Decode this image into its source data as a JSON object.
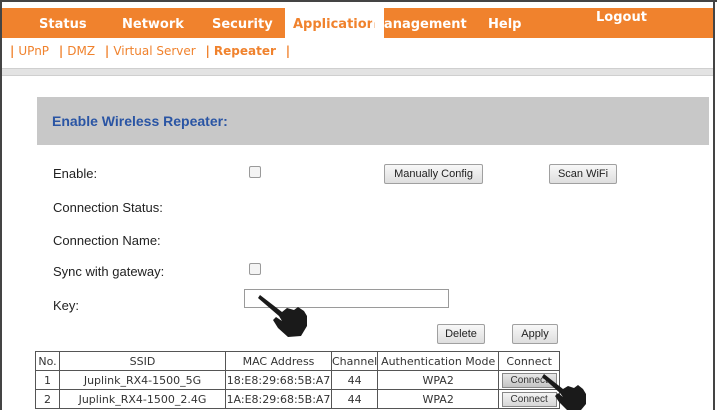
{
  "topnav": {
    "items": [
      "Status",
      "Network",
      "Security",
      "Application",
      "Management",
      "Help"
    ],
    "active": "Application",
    "logout": "Logout",
    "accent_color": "#f0822d"
  },
  "subnav": {
    "items": [
      "UPnP",
      "DMZ",
      "Virtual Server",
      "Repeater"
    ],
    "current": "Repeater"
  },
  "panel": {
    "title": "Enable Wireless Repeater:"
  },
  "form": {
    "enable_label": "Enable:",
    "enable_checked": false,
    "manual_config_button": "Manually Config",
    "scan_wifi_button": "Scan WiFi",
    "connection_status_label": "Connection Status:",
    "connection_name_label": "Connection Name:",
    "sync_label": "Sync with gateway:",
    "sync_checked": false,
    "key_label": "Key:",
    "key_value": "",
    "delete_button": "Delete",
    "apply_button": "Apply"
  },
  "ap_table": {
    "headers": [
      "No.",
      "SSID",
      "MAC Address",
      "Channel",
      "Authentication Mode",
      "Connect"
    ],
    "rows": [
      {
        "no": "1",
        "ssid": "Juplink_RX4-1500_5G",
        "mac": "18:E8:29:68:5B:A7",
        "channel": "44",
        "auth": "WPA2",
        "connect": "Connect"
      },
      {
        "no": "2",
        "ssid": "Juplink_RX4-1500_2.4G",
        "mac": "1A:E8:29:68:5B:A7",
        "channel": "44",
        "auth": "WPA2",
        "connect": "Connect"
      }
    ]
  }
}
